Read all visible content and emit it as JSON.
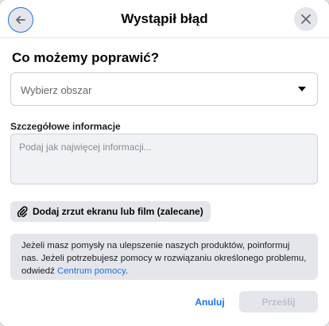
{
  "header": {
    "title": "Wystąpił błąd",
    "back_icon": "arrow-left-icon",
    "close_icon": "close-icon"
  },
  "form": {
    "section_heading": "Co możemy poprawić?",
    "area_select": {
      "value": "Wybierz obszar"
    },
    "details": {
      "label": "Szczegółowe informacje",
      "placeholder": "Podaj jak najwięcej informacji..."
    },
    "attach_button": {
      "label": "Dodaj zrzut ekranu lub film (zalecane)",
      "icon": "paperclip-icon"
    },
    "info": {
      "text": "Jeżeli masz pomysły na ulepszenie naszych produktów, poinformuj nas. Jeżeli potrzebujesz pomocy w rozwiązaniu określonego problemu, odwiedź ",
      "link": "Centrum pomocy",
      "suffix": "."
    }
  },
  "footer": {
    "cancel_label": "Anuluj",
    "submit_label": "Prześlij"
  },
  "colors": {
    "accent": "#1b74e4",
    "button_gray": "#e4e6eb",
    "disabled_text": "#bcc0c4"
  }
}
